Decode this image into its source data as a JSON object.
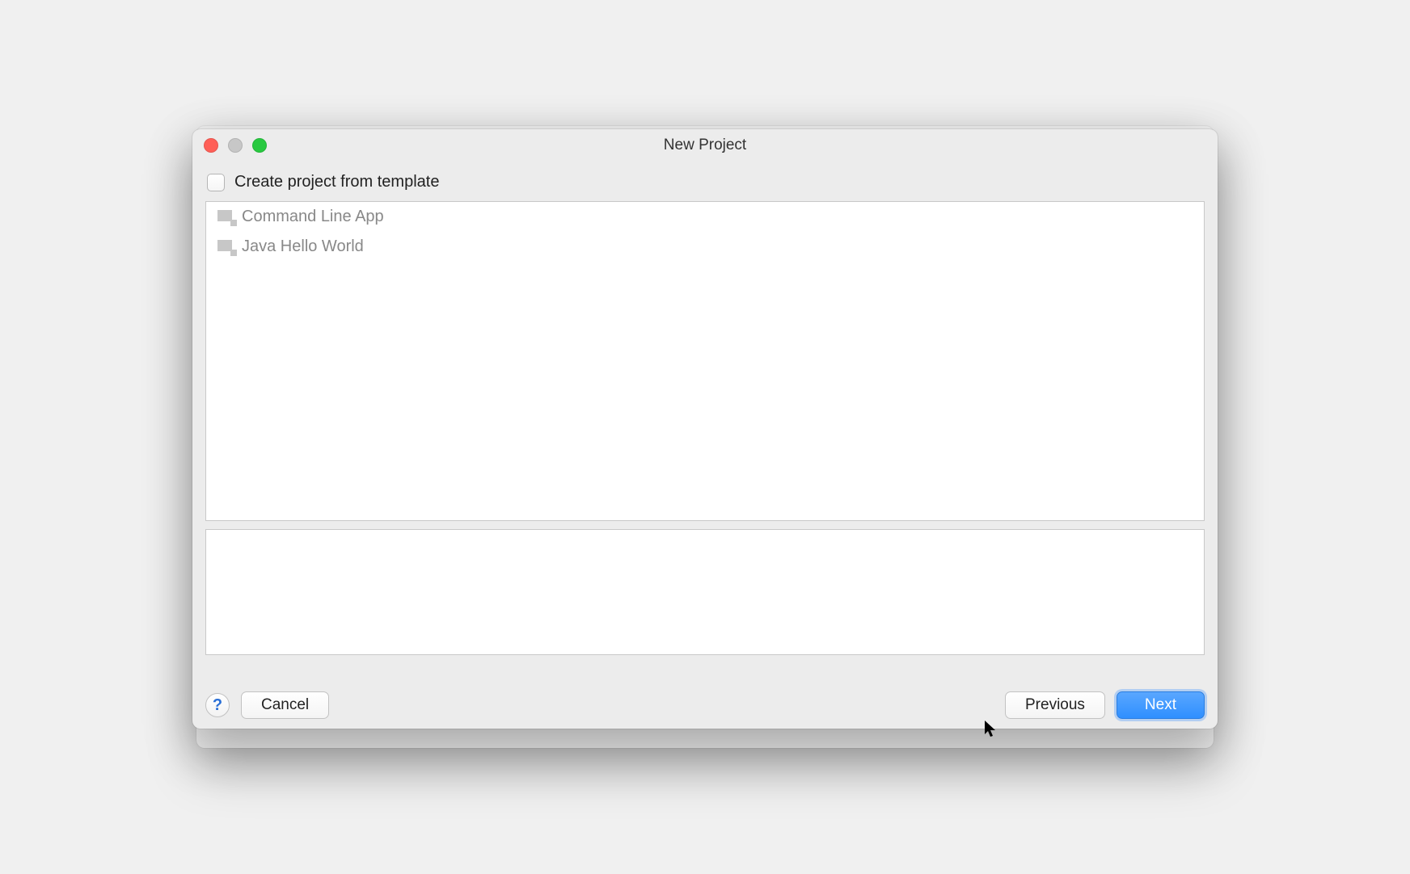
{
  "dialog": {
    "title": "New Project",
    "checkbox_label": "Create project from template",
    "templates": [
      {
        "label": "Command Line App"
      },
      {
        "label": "Java Hello World"
      }
    ],
    "buttons": {
      "help": "?",
      "cancel": "Cancel",
      "previous": "Previous",
      "next": "Next"
    }
  }
}
